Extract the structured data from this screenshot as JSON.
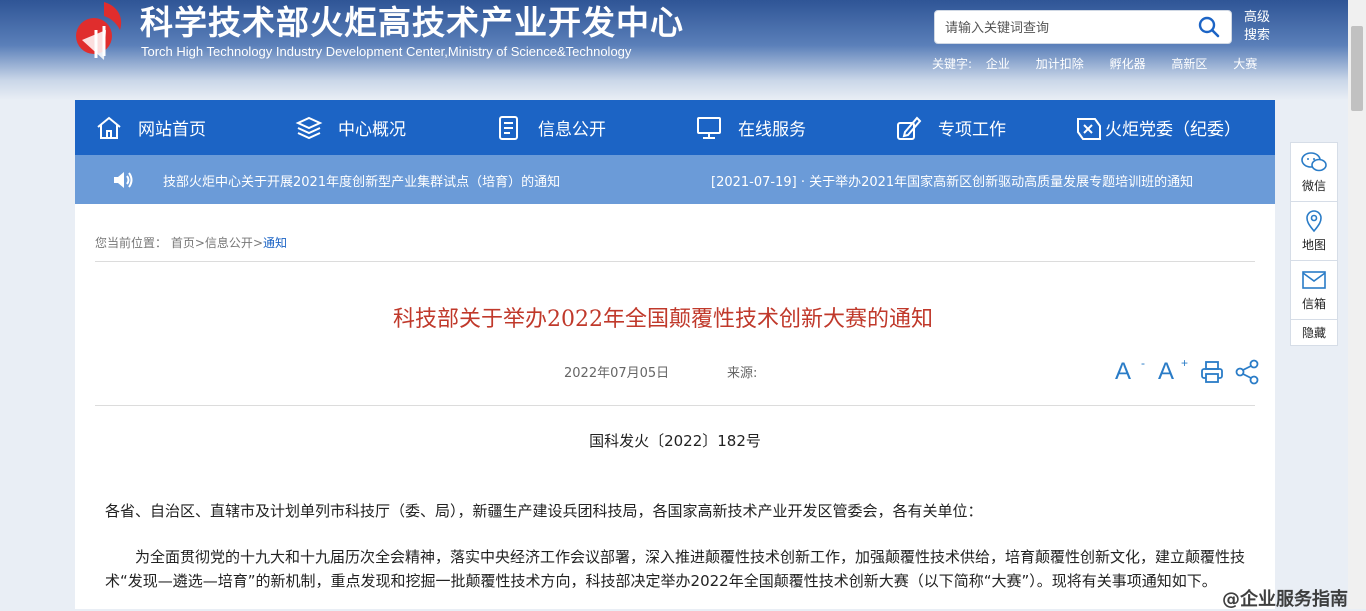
{
  "header": {
    "title": "科学技术部火炬高技术产业开发中心",
    "subtitle": "Torch High Technology Industry Development Center,Ministry of Science&Technology",
    "search_placeholder": "请输入关键词查询",
    "advanced_search": "高级搜索",
    "keywords_label": "关键字:",
    "keywords": [
      "企业",
      "加计扣除",
      "孵化器",
      "高新区",
      "大赛"
    ]
  },
  "nav": {
    "items": [
      {
        "label": "网站首页",
        "icon": "home-icon"
      },
      {
        "label": "中心概况",
        "icon": "layers-icon"
      },
      {
        "label": "信息公开",
        "icon": "document-icon"
      },
      {
        "label": "在线服务",
        "icon": "monitor-icon"
      },
      {
        "label": "专项工作",
        "icon": "edit-icon"
      },
      {
        "label": "火炬党委（纪委）",
        "icon": "party-icon"
      }
    ]
  },
  "ticker": {
    "item1": "技部火炬中心关于开展2021年度创新型产业集群试点（培育）的通知",
    "item2": "[2021-07-19]  ·  关于举办2021年国家高新区创新驱动高质量发展专题培训班的通知"
  },
  "breadcrumb": {
    "label": "您当前位置：",
    "home": "首页",
    "sep": ">",
    "section": "信息公开",
    "current": "通知"
  },
  "article": {
    "title": "科技部关于举办2022年全国颠覆性技术创新大赛的通知",
    "date": "2022年07月05日",
    "source_label": "来源:",
    "doc_number": "国科发火〔2022〕182号",
    "salutation": "各省、自治区、直辖市及计划单列市科技厅（委、局），新疆生产建设兵团科技局，各国家高新技术产业开发区管委会，各有关单位：",
    "paragraph": "为全面贯彻党的十九大和十九届历次全会精神，落实中央经济工作会议部署，深入推进颠覆性技术创新工作，加强颠覆性技术供给，培育颠覆性创新文化，建立颠覆性技术“发现—遴选—培育”的新机制，重点发现和挖掘一批颠覆性技术方向，科技部决定举办2022年全国颠覆性技术创新大赛（以下简称“大赛”）。现将有关事项通知如下。"
  },
  "tools": {
    "font_label": "A",
    "decrease": "-",
    "increase": "+"
  },
  "side_panel": {
    "wechat": "微信",
    "map": "地图",
    "mail": "信箱",
    "hide": "隐藏"
  },
  "watermark": "@企业服务指南",
  "colors": {
    "nav": "#1c64c5",
    "ticker": "#6b9bd8",
    "title_red": "#c0392b",
    "link_blue": "#1c64c5"
  }
}
